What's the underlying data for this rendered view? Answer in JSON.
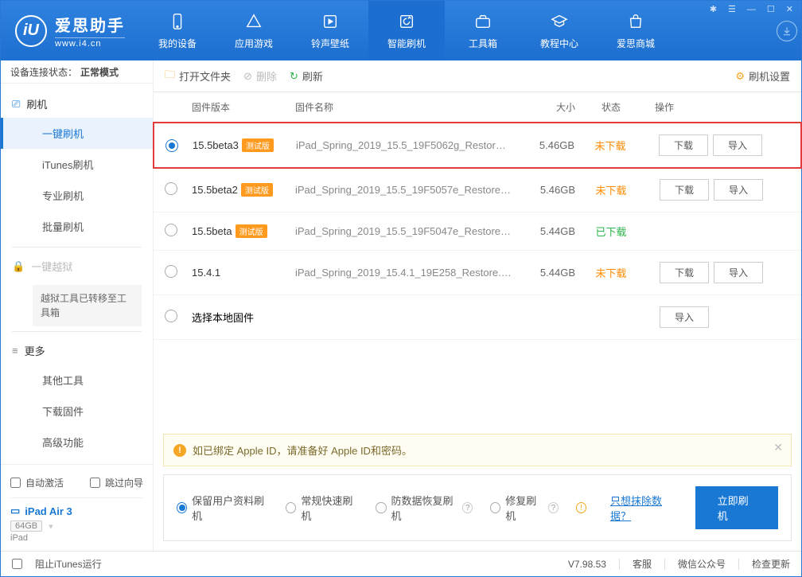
{
  "logo": {
    "mark": "iU",
    "title": "爱思助手",
    "sub": "www.i4.cn"
  },
  "nav": {
    "items": [
      {
        "label": "我的设备"
      },
      {
        "label": "应用游戏"
      },
      {
        "label": "铃声壁纸"
      },
      {
        "label": "智能刷机"
      },
      {
        "label": "工具箱"
      },
      {
        "label": "教程中心"
      },
      {
        "label": "爱思商城"
      }
    ]
  },
  "toolbar": {
    "open_folder": "打开文件夹",
    "delete": "删除",
    "refresh": "刷新",
    "settings": "刷机设置"
  },
  "sidebar": {
    "conn_label": "设备连接状态：",
    "conn_value": "正常模式",
    "flash_group": "刷机",
    "items": [
      "一键刷机",
      "iTunes刷机",
      "专业刷机",
      "批量刷机"
    ],
    "jailbreak": "一键越狱",
    "jailbreak_note": "越狱工具已转移至工具箱",
    "more_group": "更多",
    "more_items": [
      "其他工具",
      "下载固件",
      "高级功能"
    ]
  },
  "device": {
    "auto_activate": "自动激活",
    "skip_guide": "跳过向导",
    "name": "iPad Air 3",
    "capacity": "64GB",
    "type": "iPad"
  },
  "columns": {
    "version": "固件版本",
    "name": "固件名称",
    "size": "大小",
    "status": "状态",
    "ops": "操作"
  },
  "badge_beta": "测试版",
  "btn_download": "下载",
  "btn_import": "导入",
  "firmware": [
    {
      "ver": "15.5beta3",
      "beta": true,
      "name": "iPad_Spring_2019_15.5_19F5062g_Restore.ip...",
      "size": "5.46GB",
      "status": "未下载",
      "status_class": "status-pending",
      "selected": true,
      "highlight": true
    },
    {
      "ver": "15.5beta2",
      "beta": true,
      "name": "iPad_Spring_2019_15.5_19F5057e_Restore.ip...",
      "size": "5.46GB",
      "status": "未下载",
      "status_class": "status-pending"
    },
    {
      "ver": "15.5beta",
      "beta": true,
      "name": "iPad_Spring_2019_15.5_19F5047e_Restore.ip...",
      "size": "5.44GB",
      "status": "已下载",
      "status_class": "status-done",
      "no_ops": true
    },
    {
      "ver": "15.4.1",
      "beta": false,
      "name": "iPad_Spring_2019_15.4.1_19E258_Restore.ipsw",
      "size": "5.44GB",
      "status": "未下载",
      "status_class": "status-pending"
    }
  ],
  "local_firmware": "选择本地固件",
  "notice": "如已绑定 Apple ID，请准备好 Apple ID和密码。",
  "flash_options": {
    "keep_data": "保留用户资料刷机",
    "normal": "常规快速刷机",
    "anti_data": "防数据恢复刷机",
    "repair": "修复刷机",
    "erase_link": "只想抹除数据？",
    "go": "立即刷机"
  },
  "statusbar": {
    "block_itunes": "阻止iTunes运行",
    "version": "V7.98.53",
    "service": "客服",
    "wechat": "微信公众号",
    "update": "检查更新"
  }
}
